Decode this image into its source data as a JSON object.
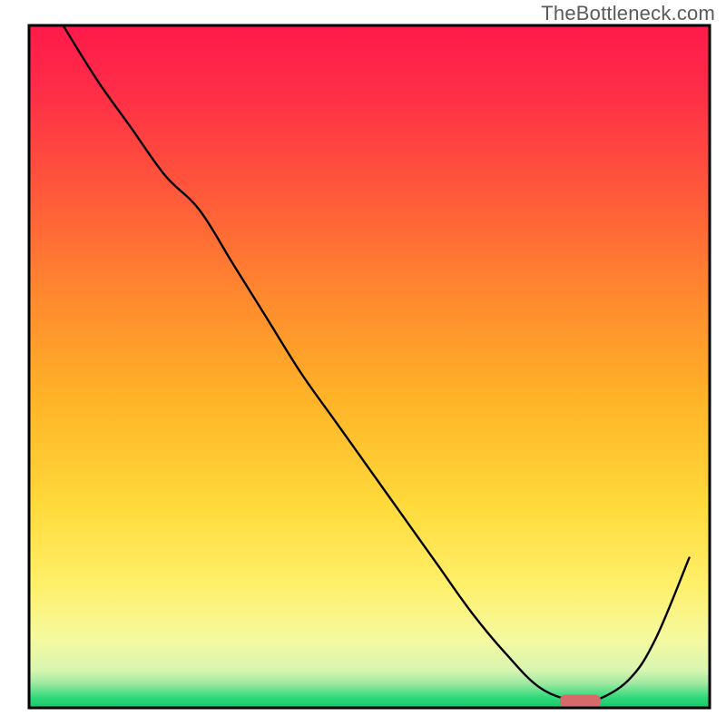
{
  "watermark": "TheBottleneck.com",
  "chart_data": {
    "type": "line",
    "title": "",
    "xlabel": "",
    "ylabel": "",
    "xlim": [
      0,
      100
    ],
    "ylim": [
      0,
      100
    ],
    "x": [
      5,
      10,
      15,
      20,
      25,
      30,
      35,
      40,
      45,
      50,
      55,
      60,
      65,
      70,
      75,
      80,
      83,
      88,
      92,
      97
    ],
    "values": [
      100,
      92,
      85,
      78,
      73,
      65,
      57,
      49,
      42,
      35,
      28,
      21,
      14,
      8,
      3,
      1,
      1,
      4,
      10,
      22
    ],
    "marker": {
      "x_start": 78,
      "x_end": 84,
      "y": 1
    },
    "gradient_stops": [
      {
        "offset": 0.0,
        "color": "#ff1a4b"
      },
      {
        "offset": 0.1,
        "color": "#ff2e47"
      },
      {
        "offset": 0.25,
        "color": "#ff5a3a"
      },
      {
        "offset": 0.4,
        "color": "#ff8a2e"
      },
      {
        "offset": 0.55,
        "color": "#ffb428"
      },
      {
        "offset": 0.7,
        "color": "#ffd93a"
      },
      {
        "offset": 0.82,
        "color": "#fff06a"
      },
      {
        "offset": 0.9,
        "color": "#f5f9a0"
      },
      {
        "offset": 0.945,
        "color": "#d8f5b0"
      },
      {
        "offset": 0.965,
        "color": "#9be8a0"
      },
      {
        "offset": 0.985,
        "color": "#2fd97a"
      },
      {
        "offset": 1.0,
        "color": "#17c76a"
      }
    ],
    "frame": {
      "stroke": "#000000",
      "width": 3
    },
    "curve": {
      "stroke": "#000000",
      "width": 2.4
    },
    "marker_style": {
      "fill": "#d66a6a",
      "rx": 6,
      "height": 14
    }
  }
}
